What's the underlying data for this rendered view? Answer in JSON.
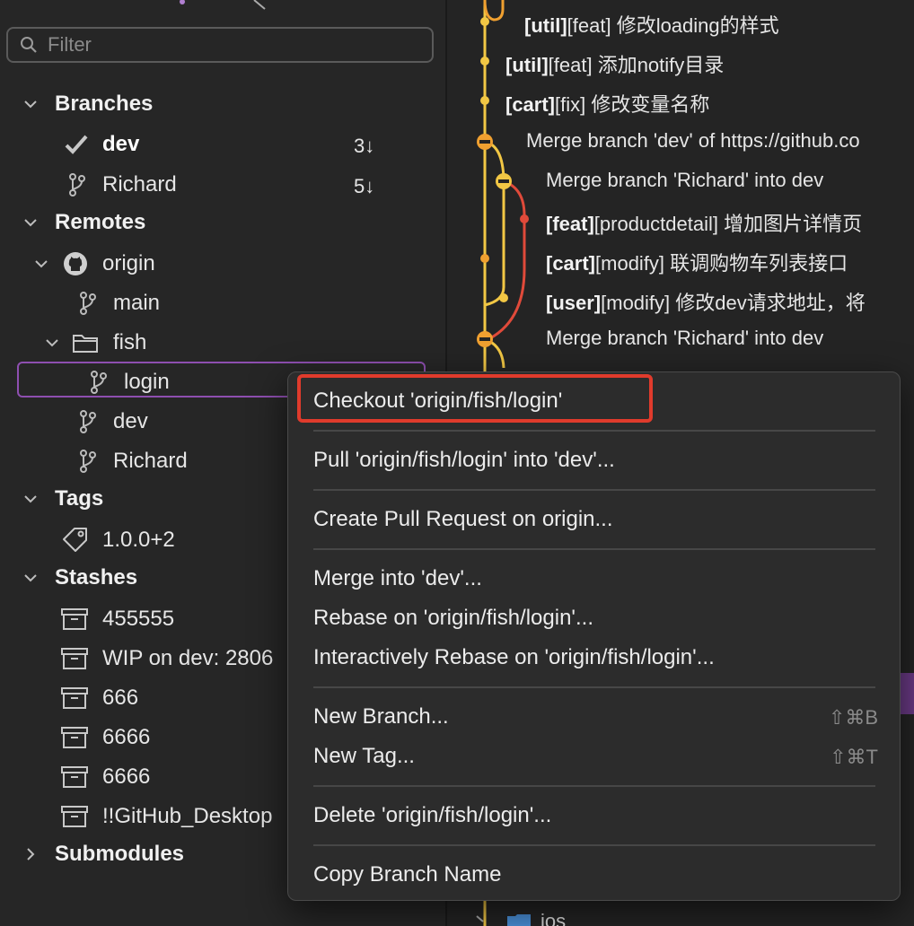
{
  "sidebar": {
    "filter_placeholder": "Filter",
    "sections": {
      "branches": "Branches",
      "remotes": "Remotes",
      "tags": "Tags",
      "stashes": "Stashes",
      "submodules": "Submodules"
    },
    "branches": [
      {
        "name": "dev",
        "count": "3↓",
        "current": true
      },
      {
        "name": "Richard",
        "count": "5↓",
        "current": false
      }
    ],
    "remotes": {
      "origin": "origin",
      "main": "main",
      "fish": "fish",
      "login": "login",
      "dev": "dev",
      "richard": "Richard"
    },
    "tags": [
      "1.0.0+2"
    ],
    "stashes": [
      "455555",
      "WIP on dev: 2806",
      "666",
      "6666",
      "6666",
      "!!GitHub_Desktop"
    ]
  },
  "commits": [
    {
      "tag": "[util]",
      "rest": "[feat] 修改loading的样式"
    },
    {
      "tag": "[util]",
      "rest": "[feat] 添加notify目录"
    },
    {
      "tag": "[cart]",
      "rest": "[fix] 修改变量名称"
    },
    {
      "tag": "",
      "rest": "Merge branch 'dev' of https://github.co"
    },
    {
      "tag": "",
      "rest": "Merge branch 'Richard' into dev"
    },
    {
      "tag": "[feat]",
      "rest": "[productdetail] 增加图片详情页"
    },
    {
      "tag": "[cart]",
      "rest": "[modify] 联调购物车列表接口"
    },
    {
      "tag": "[user]",
      "rest": "[modify] 修改dev请求地址，将"
    },
    {
      "tag": "",
      "rest": "Merge branch 'Richard' into dev"
    }
  ],
  "context_menu": {
    "checkout": "Checkout 'origin/fish/login'",
    "pull": "Pull 'origin/fish/login' into 'dev'...",
    "create_pr": "Create Pull Request on origin...",
    "merge": "Merge into 'dev'...",
    "rebase": "Rebase on 'origin/fish/login'...",
    "interactive_rebase": "Interactively Rebase on 'origin/fish/login'...",
    "new_branch": "New Branch...",
    "new_branch_shortcut": "⇧⌘B",
    "new_tag": "New Tag...",
    "new_tag_shortcut": "⇧⌘T",
    "delete": "Delete 'origin/fish/login'...",
    "copy_name": "Copy Branch Name"
  },
  "main_partial": {
    "folder_label": "ios"
  },
  "colors": {
    "graph_yellow": "#f2c744",
    "graph_orange": "#f0a030",
    "graph_red": "#e04a3a",
    "selection": "#8e4fb0",
    "highlight": "#e03b2c"
  }
}
